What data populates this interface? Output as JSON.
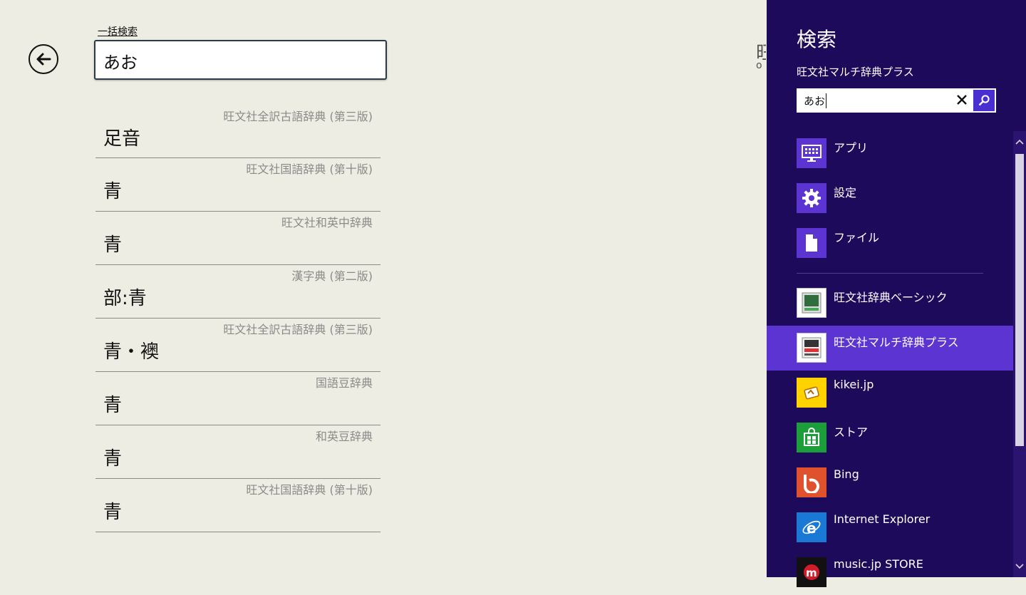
{
  "search_label": "一括検索",
  "search_value": "あお",
  "results": [
    {
      "source": "旺文社全訳古語辞典 (第三版)",
      "word": "足音"
    },
    {
      "source": "旺文社国語辞典 (第十版)",
      "word": "青"
    },
    {
      "source": "旺文社和英中辞典",
      "word": "青"
    },
    {
      "source": "漢字典 (第二版)",
      "word": "部:青"
    },
    {
      "source": "旺文社全訳古語辞典 (第三版)",
      "word": "青・襖"
    },
    {
      "source": "国語豆辞典",
      "word": "青"
    },
    {
      "source": "和英豆辞典",
      "word": "青"
    },
    {
      "source": "旺文社国語辞典 (第十版)",
      "word": "青"
    }
  ],
  "clipped_title": {
    "glyph": "旺",
    "sub": "o"
  },
  "charm": {
    "title": "検索",
    "scope": "旺文社マルチ辞典プラス",
    "query": "あお",
    "categories": [
      {
        "label": "アプリ",
        "icon": "apps-icon"
      },
      {
        "label": "設定",
        "icon": "gear-icon"
      },
      {
        "label": "ファイル",
        "icon": "file-icon"
      }
    ],
    "apps": [
      {
        "label": "旺文社辞典ベーシック",
        "icon": "obunsha-basic-icon",
        "selected": false
      },
      {
        "label": "旺文社マルチ辞典プラス",
        "icon": "obunsha-multi-icon",
        "selected": true
      },
      {
        "label": "kikei.jp",
        "icon": "kikei-icon",
        "selected": false
      },
      {
        "label": "ストア",
        "icon": "store-icon",
        "selected": false
      },
      {
        "label": "Bing",
        "icon": "bing-icon",
        "selected": false
      },
      {
        "label": "Internet Explorer",
        "icon": "ie-icon",
        "selected": false
      },
      {
        "label": "music.jp STORE",
        "icon": "musicjp-icon",
        "selected": false
      }
    ]
  },
  "colors": {
    "charm_bg": "#1e0a5b",
    "charm_selected": "#5b34d1",
    "tile_purple": "#5b34d1",
    "app_bg": "#eeede3"
  }
}
